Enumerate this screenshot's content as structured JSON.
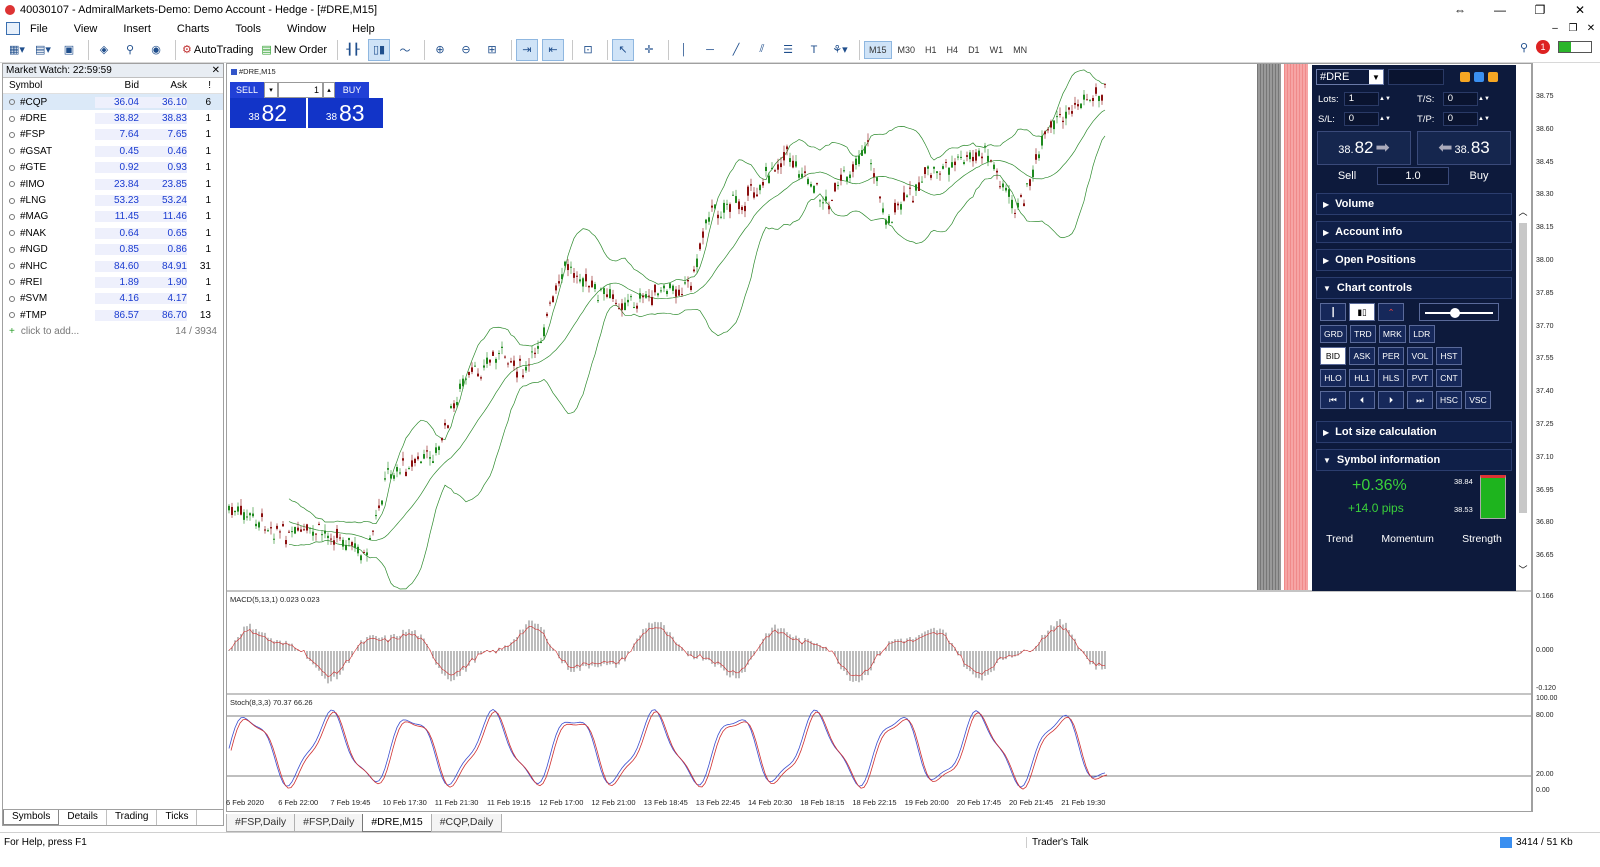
{
  "window": {
    "title": "40030107 - AdmiralMarkets-Demo: Demo Account - Hedge - [#DRE,M15]"
  },
  "menu": [
    "File",
    "View",
    "Insert",
    "Charts",
    "Tools",
    "Window",
    "Help"
  ],
  "toolbar": {
    "autotrading": "AutoTrading",
    "new_order": "New Order",
    "timeframes": [
      "M15",
      "M30",
      "H1",
      "H4",
      "D1",
      "W1",
      "MN"
    ],
    "active_timeframe": "M15",
    "notif_count": "1"
  },
  "market_watch": {
    "title": "Market Watch: 22:59:59",
    "columns": {
      "symbol": "Symbol",
      "bid": "Bid",
      "ask": "Ask",
      "spread": "!"
    },
    "rows": [
      {
        "symbol": "#CQP",
        "bid": "36.04",
        "ask": "36.10",
        "spread": "6"
      },
      {
        "symbol": "#DRE",
        "bid": "38.82",
        "ask": "38.83",
        "spread": "1"
      },
      {
        "symbol": "#FSP",
        "bid": "7.64",
        "ask": "7.65",
        "spread": "1"
      },
      {
        "symbol": "#GSAT",
        "bid": "0.45",
        "ask": "0.46",
        "spread": "1"
      },
      {
        "symbol": "#GTE",
        "bid": "0.92",
        "ask": "0.93",
        "spread": "1"
      },
      {
        "symbol": "#IMO",
        "bid": "23.84",
        "ask": "23.85",
        "spread": "1"
      },
      {
        "symbol": "#LNG",
        "bid": "53.23",
        "ask": "53.24",
        "spread": "1"
      },
      {
        "symbol": "#MAG",
        "bid": "11.45",
        "ask": "11.46",
        "spread": "1"
      },
      {
        "symbol": "#NAK",
        "bid": "0.64",
        "ask": "0.65",
        "spread": "1"
      },
      {
        "symbol": "#NGD",
        "bid": "0.85",
        "ask": "0.86",
        "spread": "1"
      },
      {
        "symbol": "#NHC",
        "bid": "84.60",
        "ask": "84.91",
        "spread": "31"
      },
      {
        "symbol": "#REI",
        "bid": "1.89",
        "ask": "1.90",
        "spread": "1"
      },
      {
        "symbol": "#SVM",
        "bid": "4.16",
        "ask": "4.17",
        "spread": "1"
      },
      {
        "symbol": "#TMP",
        "bid": "86.57",
        "ask": "86.70",
        "spread": "13"
      }
    ],
    "add_label": "click to add...",
    "count": "14 / 3934",
    "tabs": [
      "Symbols",
      "Details",
      "Trading",
      "Ticks"
    ]
  },
  "chart": {
    "title": "#DRE,M15",
    "oneclick": {
      "sell": "SELL",
      "buy": "BUY",
      "lot": "1",
      "sell_big": "82",
      "sell_small": "38",
      "buy_big": "83",
      "buy_small": "38"
    },
    "macd_label": "MACD(5,13,1) 0.023 0.023",
    "stoch_label": "Stoch(8,3,3) 70.37 66.26",
    "price_axis": [
      "38.75",
      "38.60",
      "38.45",
      "38.30",
      "38.15",
      "38.00",
      "37.85",
      "37.70",
      "37.55",
      "37.40",
      "37.25",
      "37.10",
      "36.95",
      "36.80",
      "36.65"
    ],
    "macd_axis": [
      "0.166",
      "0.000",
      "-0.120"
    ],
    "stoch_axis": [
      "100.00",
      "80.00",
      "20.00",
      "0.00"
    ],
    "time_axis": [
      "6 Feb 2020",
      "6 Feb 22:00",
      "7 Feb 19:45",
      "10 Feb 17:30",
      "11 Feb 21:30",
      "11 Feb 19:15",
      "12 Feb 17:00",
      "12 Feb 21:00",
      "13 Feb 18:45",
      "13 Feb 22:45",
      "14 Feb 20:30",
      "18 Feb 18:15",
      "18 Feb 22:15",
      "19 Feb 20:00",
      "20 Feb 17:45",
      "20 Feb 21:45",
      "21 Feb 19:30"
    ]
  },
  "trade_panel": {
    "symbol": "#DRE",
    "lots_label": "Lots:",
    "lots": "1",
    "ts_label": "T/S:",
    "ts": "0",
    "sl_label": "S/L:",
    "sl": "0",
    "tp_label": "T/P:",
    "tp": "0",
    "sell_small": "38.",
    "sell_big": "82",
    "buy_small": "38.",
    "buy_big": "83",
    "sell_label": "Sell",
    "buy_label": "Buy",
    "lot_value": "1.0",
    "sections": {
      "volume": "Volume",
      "account": "Account info",
      "positions": "Open Positions",
      "chart_controls": "Chart controls",
      "lot_calc": "Lot size calculation",
      "symbol_info": "Symbol information"
    },
    "cc_row2": [
      "GRD",
      "TRD",
      "MRK",
      "LDR"
    ],
    "cc_row3": [
      "BID",
      "ASK",
      "PER",
      "VOL",
      "HST"
    ],
    "cc_row4": [
      "HLO",
      "HL1",
      "HLS",
      "PVT",
      "CNT"
    ],
    "cc_row5_text": [
      "HSC",
      "VSC"
    ],
    "symbol_info": {
      "pct": "+0.36%",
      "pips": "+14.0 pips",
      "high": "38.84",
      "low": "38.53",
      "labels": [
        "Trend",
        "Momentum",
        "Strength"
      ]
    }
  },
  "chart_tabs": [
    "#FSP,Daily",
    "#FSP,Daily",
    "#DRE,M15",
    "#CQP,Daily"
  ],
  "status": {
    "help": "For Help, press F1",
    "traders_talk": "Trader's Talk",
    "traffic": "3414 / 51 Kb"
  },
  "colors": {
    "sell_blue": "#1234c8",
    "panel_bg": "#0d1a3c",
    "bollinger": "#2e8b2e",
    "candle_up": "#1f8a1f",
    "candle_down": "#8b1010",
    "macd": "#222222",
    "stoch_main": "#3b4fd0",
    "stoch_signal": "#d03030"
  }
}
